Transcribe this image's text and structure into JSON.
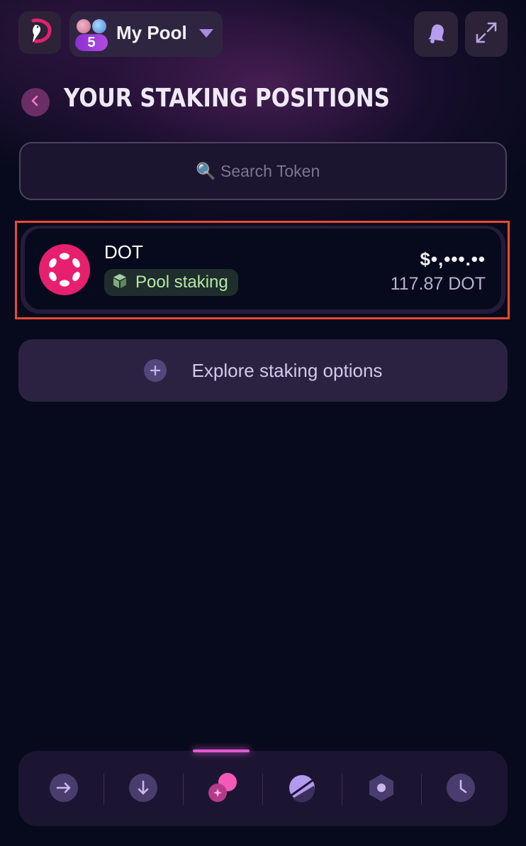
{
  "header": {
    "account_name": "My Pool",
    "account_count": "5",
    "icons": [
      "app-logo-icon",
      "avatar-pink",
      "avatar-blue",
      "chevron-down-icon",
      "bell-icon",
      "expand-icon"
    ]
  },
  "page": {
    "title": "YOUR STAKING POSITIONS",
    "back_icon": "chevron-left-icon"
  },
  "search": {
    "placeholder": "🔍 Search Token"
  },
  "positions": [
    {
      "token": "DOT",
      "type": "Pool staking",
      "usd_value": "$•,•••.••",
      "amount": "117.87 DOT",
      "token_icon": "polkadot-icon",
      "type_icon": "cube-icon"
    }
  ],
  "explore": {
    "label": "Explore staking options"
  },
  "bottom_nav": {
    "items": [
      "send-icon",
      "receive-icon",
      "staking-icon",
      "governance-icon",
      "nft-icon",
      "history-icon"
    ],
    "active_index": 2
  },
  "colors": {
    "background": "#070a1c",
    "accent_pink": "#e6206f",
    "badge_text": "#b9e6a8",
    "highlight_outline": "#e84a33"
  }
}
